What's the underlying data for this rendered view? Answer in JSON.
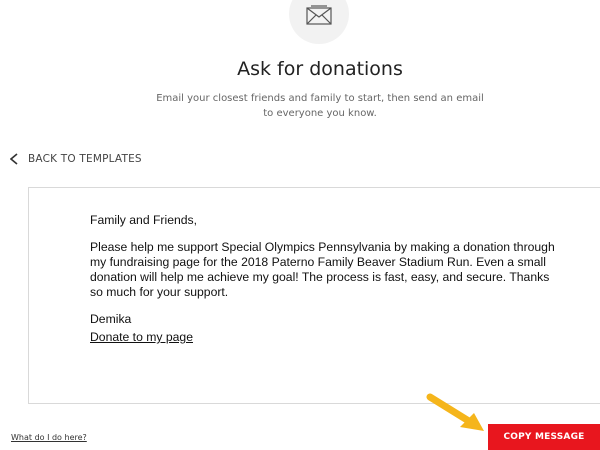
{
  "header": {
    "icon": "envelope-icon",
    "title": "Ask for donations",
    "subtitle": "Email your closest friends and family to start, then send an email to everyone you know."
  },
  "nav": {
    "back_icon": "chevron-left-icon",
    "back_label": "BACK TO TEMPLATES"
  },
  "message": {
    "greeting": "Family and Friends,",
    "body": "Please help me support Special Olympics Pennsylvania by making a donation through my fundraising page for the 2018 Paterno Family Beaver Stadium Run. Even a small donation will help me achieve my goal! The process is fast, easy, and secure. Thanks so much for your support.",
    "signature": "Demika",
    "link_label": "Donate to my page"
  },
  "footer": {
    "help_label": "What do I do here?",
    "copy_label": "COPY MESSAGE"
  },
  "annotation": {
    "icon": "arrow-icon",
    "color": "#f5b51b"
  },
  "colors": {
    "accent": "#e8161e",
    "icon_circle": "#f2f2f2"
  }
}
